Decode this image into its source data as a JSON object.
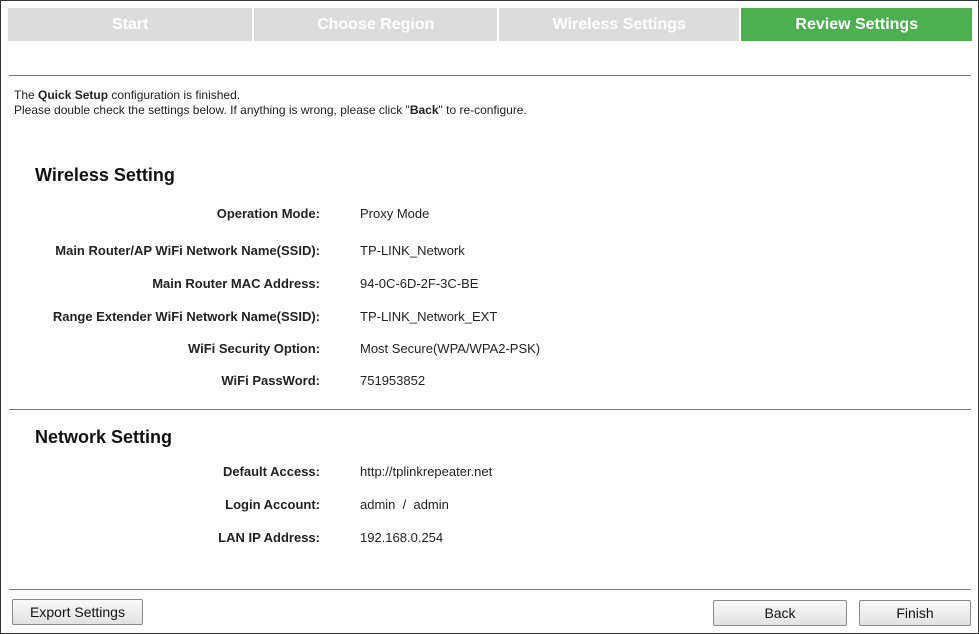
{
  "tabs": [
    {
      "label": "Start",
      "active": false
    },
    {
      "label": "Choose Region",
      "active": false
    },
    {
      "label": "Wireless Settings",
      "active": false
    },
    {
      "label": "Review Settings",
      "active": true
    }
  ],
  "intro": {
    "line1_prefix": "The ",
    "line1_bold": "Quick Setup",
    "line1_suffix": " configuration is finished.",
    "line2_prefix": "Please double check the settings below. If anything is wrong, please click \"",
    "line2_bold": "Back",
    "line2_suffix": "\" to re-configure."
  },
  "wireless": {
    "title": "Wireless Setting",
    "rows": [
      {
        "label": "Operation Mode:",
        "value": "Proxy Mode"
      },
      {
        "label": "Main Router/AP WiFi Network Name(SSID):",
        "value": "TP-LINK_Network"
      },
      {
        "label": "Main Router MAC Address:",
        "value": "94-0C-6D-2F-3C-BE"
      },
      {
        "label": "Range Extender WiFi Network Name(SSID):",
        "value": "TP-LINK_Network_EXT"
      },
      {
        "label": "WiFi Security Option:",
        "value": "Most Secure(WPA/WPA2-PSK)"
      },
      {
        "label": "WiFi PassWord:",
        "value": "751953852"
      }
    ]
  },
  "network": {
    "title": "Network Setting",
    "rows": [
      {
        "label": "Default Access:",
        "value": "http://tplinkrepeater.net"
      },
      {
        "label": "Login Account:",
        "value": "admin  /  admin"
      },
      {
        "label": "LAN IP Address:",
        "value": "192.168.0.254"
      }
    ]
  },
  "buttons": {
    "export": "Export Settings",
    "back": "Back",
    "finish": "Finish"
  },
  "colors": {
    "active_tab": "#4caf50",
    "inactive_tab": "#dcdcdc",
    "rule": "#4a9a4e"
  }
}
